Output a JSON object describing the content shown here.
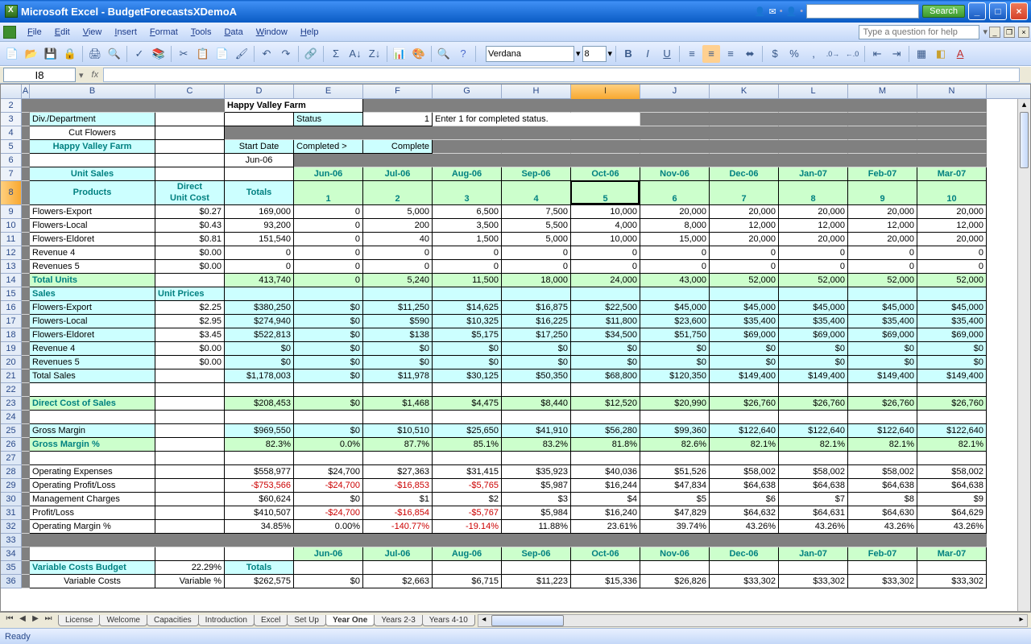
{
  "titlebar": {
    "app": "Microsoft Excel",
    "doc": "BudgetForecastsXDemoA",
    "search_btn": "Search"
  },
  "menus": [
    "File",
    "Edit",
    "View",
    "Insert",
    "Format",
    "Tools",
    "Data",
    "Window",
    "Help"
  ],
  "help_placeholder": "Type a question for help",
  "toolbar": {
    "font": "Verdana",
    "size": "8"
  },
  "name_box": "I8",
  "status": "Ready",
  "tabs": [
    "License",
    "Welcome",
    "Capacities",
    "Introduction",
    "Excel",
    "Set Up",
    "Year One",
    "Years 2-3",
    "Years 4-10"
  ],
  "active_tab": "Year One",
  "cols": {
    "A": {
      "w": 10
    },
    "B": {
      "w": 156
    },
    "C": {
      "w": 86
    },
    "D": {
      "w": 86
    },
    "E": {
      "w": 86
    },
    "F": {
      "w": 86
    },
    "G": {
      "w": 86
    },
    "H": {
      "w": 86
    },
    "I": {
      "w": 86
    },
    "J": {
      "w": 86
    },
    "K": {
      "w": 86
    },
    "L": {
      "w": 86
    },
    "M": {
      "w": 86
    },
    "N": {
      "w": 86
    }
  },
  "selected_col": "I",
  "selected_row": 8,
  "headers": {
    "title_company": "Happy Valley Farm",
    "div_dep": "Div./Department",
    "cut_flowers": "Cut Flowers",
    "status_lbl": "Status",
    "status_val": "1",
    "status_note": "Enter 1 for completed status.",
    "company2": "Happy Valley Farm",
    "start_date": "Start Date",
    "completed": "Completed >",
    "complete": "Complete",
    "jun06": "Jun-06",
    "unit_sales": "Unit Sales",
    "direct_unit": "Direct Unit Cost",
    "totals": "Totals",
    "products": "Products",
    "months": [
      "Jun-06",
      "Jul-06",
      "Aug-06",
      "Sep-06",
      "Oct-06",
      "Nov-06",
      "Dec-06",
      "Jan-07",
      "Feb-07",
      "Mar-07"
    ],
    "month_nums": [
      "1",
      "2",
      "3",
      "4",
      "5",
      "6",
      "7",
      "8",
      "9",
      "10"
    ]
  },
  "rows": [
    {
      "r": 9,
      "label": "Flowers-Export",
      "c": "$0.27",
      "d": "169,000",
      "vals": [
        "0",
        "5,000",
        "6,500",
        "7,500",
        "10,000",
        "20,000",
        "20,000",
        "20,000",
        "20,000",
        "20,000"
      ]
    },
    {
      "r": 10,
      "label": "Flowers-Local",
      "c": "$0.43",
      "d": "93,200",
      "vals": [
        "0",
        "200",
        "3,500",
        "5,500",
        "4,000",
        "8,000",
        "12,000",
        "12,000",
        "12,000",
        "12,000"
      ]
    },
    {
      "r": 11,
      "label": "Flowers-Eldoret",
      "c": "$0.81",
      "d": "151,540",
      "vals": [
        "0",
        "40",
        "1,500",
        "5,000",
        "10,000",
        "15,000",
        "20,000",
        "20,000",
        "20,000",
        "20,000"
      ]
    },
    {
      "r": 12,
      "label": "Revenue 4",
      "c": "$0.00",
      "d": "0",
      "vals": [
        "0",
        "0",
        "0",
        "0",
        "0",
        "0",
        "0",
        "0",
        "0",
        "0"
      ]
    },
    {
      "r": 13,
      "label": "Revenues 5",
      "c": "$0.00",
      "d": "0",
      "vals": [
        "0",
        "0",
        "0",
        "0",
        "0",
        "0",
        "0",
        "0",
        "0",
        "0"
      ]
    },
    {
      "r": 14,
      "label": "Total Units",
      "c": "",
      "d": "413,740",
      "vals": [
        "0",
        "5,240",
        "11,500",
        "18,000",
        "24,000",
        "43,000",
        "52,000",
        "52,000",
        "52,000",
        "52,000"
      ],
      "style": "green"
    },
    {
      "r": 15,
      "label": "Sales",
      "c": "Unit Prices",
      "style": "cyan-hdr"
    },
    {
      "r": 16,
      "label": "Flowers-Export",
      "c": "$2.25",
      "d": "$380,250",
      "vals": [
        "$0",
        "$11,250",
        "$14,625",
        "$16,875",
        "$22,500",
        "$45,000",
        "$45,000",
        "$45,000",
        "$45,000",
        "$45,000"
      ],
      "style": "cyan"
    },
    {
      "r": 17,
      "label": "Flowers-Local",
      "c": "$2.95",
      "d": "$274,940",
      "vals": [
        "$0",
        "$590",
        "$10,325",
        "$16,225",
        "$11,800",
        "$23,600",
        "$35,400",
        "$35,400",
        "$35,400",
        "$35,400"
      ],
      "style": "cyan"
    },
    {
      "r": 18,
      "label": "Flowers-Eldoret",
      "c": "$3.45",
      "d": "$522,813",
      "vals": [
        "$0",
        "$138",
        "$5,175",
        "$17,250",
        "$34,500",
        "$51,750",
        "$69,000",
        "$69,000",
        "$69,000",
        "$69,000"
      ],
      "style": "cyan"
    },
    {
      "r": 19,
      "label": "Revenue 4",
      "c": "$0.00",
      "d": "$0",
      "vals": [
        "$0",
        "$0",
        "$0",
        "$0",
        "$0",
        "$0",
        "$0",
        "$0",
        "$0",
        "$0"
      ],
      "style": "cyan"
    },
    {
      "r": 20,
      "label": "Revenues 5",
      "c": "$0.00",
      "d": "$0",
      "vals": [
        "$0",
        "$0",
        "$0",
        "$0",
        "$0",
        "$0",
        "$0",
        "$0",
        "$0",
        "$0"
      ],
      "style": "cyan"
    },
    {
      "r": 21,
      "label": "Total Sales",
      "c": "",
      "d": "$1,178,003",
      "vals": [
        "$0",
        "$11,978",
        "$30,125",
        "$50,350",
        "$68,800",
        "$120,350",
        "$149,400",
        "$149,400",
        "$149,400",
        "$149,400"
      ],
      "style": "cyan"
    },
    {
      "r": 22,
      "blank": true
    },
    {
      "r": 23,
      "label": "Direct Cost of Sales",
      "c": "",
      "d": "$208,453",
      "vals": [
        "$0",
        "$1,468",
        "$4,475",
        "$8,440",
        "$12,520",
        "$20,990",
        "$26,760",
        "$26,760",
        "$26,760",
        "$26,760"
      ],
      "style": "green"
    },
    {
      "r": 24,
      "blank": true
    },
    {
      "r": 25,
      "label": "Gross Margin",
      "c": "",
      "d": "$969,550",
      "vals": [
        "$0",
        "$10,510",
        "$25,650",
        "$41,910",
        "$56,280",
        "$99,360",
        "$122,640",
        "$122,640",
        "$122,640",
        "$122,640"
      ],
      "style": "cyan"
    },
    {
      "r": 26,
      "label": "Gross Margin %",
      "c": "",
      "d": "82.3%",
      "vals": [
        "0.0%",
        "87.7%",
        "85.1%",
        "83.2%",
        "81.8%",
        "82.6%",
        "82.1%",
        "82.1%",
        "82.1%",
        "82.1%"
      ],
      "style": "green"
    },
    {
      "r": 27,
      "blank": true
    },
    {
      "r": 28,
      "label": "Operating Expenses",
      "c": "",
      "d": "$558,977",
      "vals": [
        "$24,700",
        "$27,363",
        "$31,415",
        "$35,923",
        "$40,036",
        "$51,526",
        "$58,002",
        "$58,002",
        "$58,002",
        "$58,002"
      ]
    },
    {
      "r": 29,
      "label": "Operating Profit/Loss",
      "c": "",
      "d": "-$753,566",
      "vals": [
        "-$24,700",
        "-$16,853",
        "-$5,765",
        "$5,987",
        "$16,244",
        "$47,834",
        "$64,638",
        "$64,638",
        "$64,638",
        "$64,638"
      ],
      "negs": [
        0,
        1,
        2,
        3
      ]
    },
    {
      "r": 30,
      "label": "Management Charges",
      "c": "",
      "d": "$60,624",
      "vals": [
        "$0",
        "$1",
        "$2",
        "$3",
        "$4",
        "$5",
        "$6",
        "$7",
        "$8",
        "$9"
      ]
    },
    {
      "r": 31,
      "label": "Profit/Loss",
      "c": "",
      "d": "$410,507",
      "vals": [
        "-$24,700",
        "-$16,854",
        "-$5,767",
        "$5,984",
        "$16,240",
        "$47,829",
        "$64,632",
        "$64,631",
        "$64,630",
        "$64,629"
      ],
      "negs": [
        1,
        2,
        3
      ]
    },
    {
      "r": 32,
      "label": "Operating Margin %",
      "c": "",
      "d": "34.85%",
      "vals": [
        "0.00%",
        "-140.77%",
        "-19.14%",
        "11.88%",
        "23.61%",
        "39.74%",
        "43.26%",
        "43.26%",
        "43.26%",
        "43.26%"
      ],
      "negs": [
        2,
        3
      ]
    },
    {
      "r": 33,
      "blank": true,
      "gray": true
    },
    {
      "r": 34,
      "month_hdr": true
    },
    {
      "r": 35,
      "label": "Variable Costs Budget",
      "c": "22.29%",
      "d": "Totals",
      "style": "cyan-hdr2"
    },
    {
      "r": 36,
      "label": "Variable Costs",
      "c": "Variable %",
      "d": "$262,575",
      "vals": [
        "$0",
        "$2,663",
        "$6,715",
        "$11,223",
        "$15,336",
        "$26,826",
        "$33,302",
        "$33,302",
        "$33,302",
        "$33,302"
      ],
      "indent": true
    }
  ]
}
